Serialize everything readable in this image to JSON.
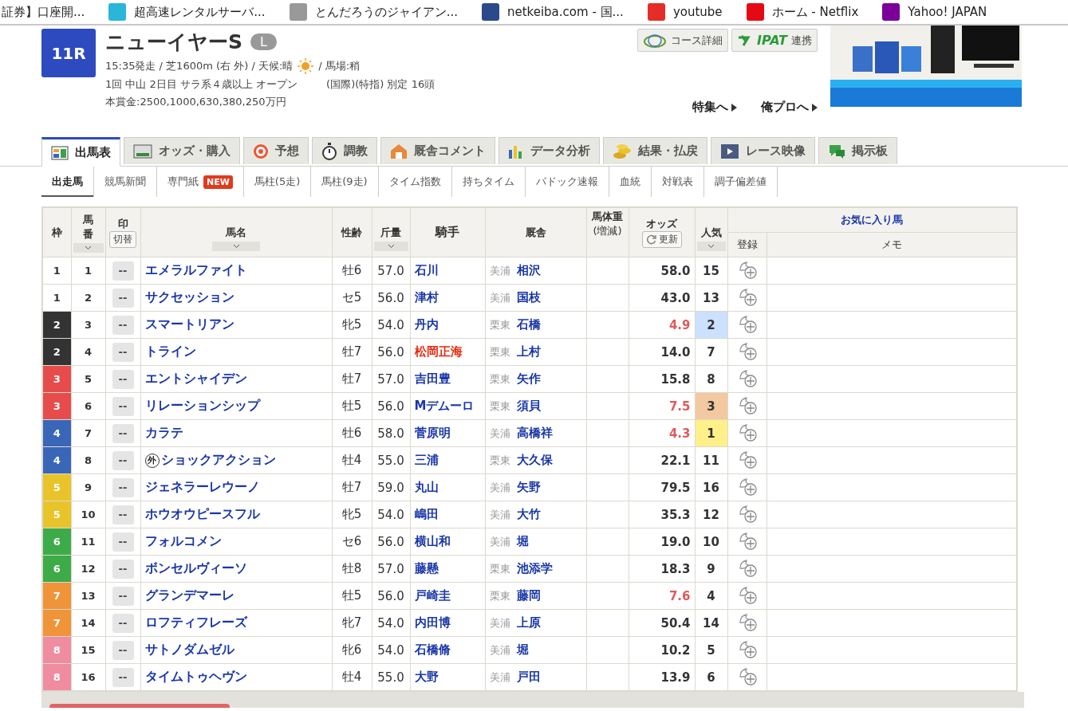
{
  "bookmarks": [
    {
      "label": "証券】口座開..."
    },
    {
      "label": "超高速レンタルサーバ..."
    },
    {
      "label": "とんだろうのジャイアン..."
    },
    {
      "label": "netkeiba.com - 国..."
    },
    {
      "label": "youtube"
    },
    {
      "label": "ホーム - Netflix"
    },
    {
      "label": "Yahoo! JAPAN"
    }
  ],
  "race": {
    "number": "11R",
    "name": "ニューイヤーS",
    "grade": "L",
    "line1_a": "15:35発走 / 芝1600m (右 外) / 天候:晴",
    "line1_b": "/ 馬場:稍",
    "line2_a": "1回 中山 2日目 サラ系４歳以上 オープン",
    "line2_b": "(国際)(特指) 別定 16頭",
    "prize": "本賞金:2500,1000,630,380,250万円"
  },
  "buttons": [
    {
      "kind": "course",
      "label": "コース詳細"
    },
    {
      "kind": "ipat",
      "logo": "IPAT",
      "label": "連携"
    }
  ],
  "links": [
    "特集へ",
    "俺プロへ"
  ],
  "tabs": [
    {
      "label": "出馬表",
      "selected": true
    },
    {
      "label": "オッズ・購入",
      "selected": false
    },
    {
      "label": "予想",
      "selected": false
    },
    {
      "label": "調教",
      "selected": false
    },
    {
      "label": "厩舎コメント",
      "selected": false
    },
    {
      "label": "データ分析",
      "selected": false
    },
    {
      "label": "結果・払戻",
      "selected": false
    },
    {
      "label": "レース映像",
      "selected": false
    },
    {
      "label": "掲示板",
      "selected": false
    }
  ],
  "subtabs": [
    {
      "label": "出走馬",
      "selected": true
    },
    {
      "label": "競馬新聞",
      "selected": false
    },
    {
      "label": "専門紙",
      "badge": "NEW",
      "selected": false
    },
    {
      "label": "馬柱(5走)",
      "selected": false
    },
    {
      "label": "馬柱(9走)",
      "selected": false
    },
    {
      "label": "タイム指数",
      "selected": false
    },
    {
      "label": "持ちタイム",
      "selected": false
    },
    {
      "label": "パドック速報",
      "selected": false
    },
    {
      "label": "血統",
      "selected": false
    },
    {
      "label": "対戦表",
      "selected": false
    },
    {
      "label": "調子偏差値",
      "selected": false
    }
  ],
  "table": {
    "headers": {
      "waku": "枠",
      "umaban": [
        "馬",
        "番"
      ],
      "mark": "印",
      "mark_toggle": "切替",
      "name": "馬名",
      "sex_age": "性齢",
      "weight": "斤量",
      "jockey": "騎手",
      "trainer": "厩舎",
      "body_weight": [
        "馬体重",
        "(増減)"
      ],
      "odds": "オッズ",
      "refresh": "更新",
      "popularity": "人気",
      "favorites": "お気に入り馬",
      "register": "登録",
      "memo": "メモ"
    },
    "mark_placeholder": "--",
    "rows": [
      {
        "waku": "1",
        "color": "#ffffff",
        "num": "1",
        "name": "エメラルファイト",
        "sex_age": "牡6",
        "weight": "57.0",
        "jockey": "石川",
        "jockey_alert": false,
        "region": "美浦",
        "trainer": "相沢",
        "odds": "58.0",
        "odds_hot": false,
        "popularity": {
          "text": "15"
        }
      },
      {
        "waku": "1",
        "color": "#ffffff",
        "num": "2",
        "name": "サクセッション",
        "sex_age": "セ5",
        "weight": "56.0",
        "jockey": "津村",
        "jockey_alert": false,
        "region": "美浦",
        "trainer": "国枝",
        "odds": "43.0",
        "odds_hot": false,
        "popularity": {
          "text": "13"
        }
      },
      {
        "waku": "2",
        "color": "#333333",
        "num": "3",
        "name": "スマートリアン",
        "sex_age": "牝5",
        "weight": "54.0",
        "jockey": "丹内",
        "jockey_alert": false,
        "region": "栗東",
        "trainer": "石橋",
        "odds": "4.9",
        "odds_hot": true,
        "popularity": {
          "text": "2",
          "color": "#cce0ff"
        }
      },
      {
        "waku": "2",
        "color": "#333333",
        "num": "4",
        "name": "トライン",
        "sex_age": "牡7",
        "weight": "56.0",
        "jockey": "松岡正海",
        "jockey_alert": true,
        "region": "栗東",
        "trainer": "上村",
        "odds": "14.0",
        "odds_hot": false,
        "popularity": {
          "text": "7"
        }
      },
      {
        "waku": "3",
        "color": "#e74c4c",
        "num": "5",
        "name": "エントシャイデン",
        "sex_age": "牡7",
        "weight": "57.0",
        "jockey": "吉田豊",
        "jockey_alert": false,
        "region": "栗東",
        "trainer": "矢作",
        "odds": "15.8",
        "odds_hot": false,
        "popularity": {
          "text": "8"
        }
      },
      {
        "waku": "3",
        "color": "#e74c4c",
        "num": "6",
        "name": "リレーションシップ",
        "sex_age": "牡5",
        "weight": "56.0",
        "jockey": "Mデムーロ",
        "jockey_alert": false,
        "region": "栗東",
        "trainer": "須貝",
        "odds": "7.5",
        "odds_hot": true,
        "popularity": {
          "text": "3",
          "color": "#f2c9a0"
        }
      },
      {
        "waku": "4",
        "color": "#3a66b8",
        "num": "7",
        "name": "カラテ",
        "sex_age": "牡6",
        "weight": "58.0",
        "jockey": "菅原明",
        "jockey_alert": false,
        "region": "美浦",
        "trainer": "高橋祥",
        "odds": "4.3",
        "odds_hot": true,
        "popularity": {
          "text": "1",
          "color": "#fff08a"
        }
      },
      {
        "waku": "4",
        "color": "#3a66b8",
        "num": "8",
        "foreign": "外",
        "name": "ショックアクション",
        "sex_age": "牡4",
        "weight": "55.0",
        "jockey": "三浦",
        "jockey_alert": false,
        "region": "栗東",
        "trainer": "大久保",
        "odds": "22.1",
        "odds_hot": false,
        "popularity": {
          "text": "11"
        }
      },
      {
        "waku": "5",
        "color": "#e8c42a",
        "num": "9",
        "name": "ジェネラーレウーノ",
        "sex_age": "牡7",
        "weight": "59.0",
        "jockey": "丸山",
        "jockey_alert": false,
        "region": "美浦",
        "trainer": "矢野",
        "odds": "79.5",
        "odds_hot": false,
        "popularity": {
          "text": "16"
        }
      },
      {
        "waku": "5",
        "color": "#e8c42a",
        "num": "10",
        "name": "ホウオウピースフル",
        "sex_age": "牝5",
        "weight": "54.0",
        "jockey": "嶋田",
        "jockey_alert": false,
        "region": "美浦",
        "trainer": "大竹",
        "odds": "35.3",
        "odds_hot": false,
        "popularity": {
          "text": "12"
        }
      },
      {
        "waku": "6",
        "color": "#3cab48",
        "num": "11",
        "name": "フォルコメン",
        "sex_age": "セ6",
        "weight": "56.0",
        "jockey": "横山和",
        "jockey_alert": false,
        "region": "美浦",
        "trainer": "堀",
        "odds": "19.0",
        "odds_hot": false,
        "popularity": {
          "text": "10"
        }
      },
      {
        "waku": "6",
        "color": "#3cab48",
        "num": "12",
        "name": "ボンセルヴィーソ",
        "sex_age": "牡8",
        "weight": "57.0",
        "jockey": "藤懸",
        "jockey_alert": false,
        "region": "栗東",
        "trainer": "池添学",
        "odds": "18.3",
        "odds_hot": false,
        "popularity": {
          "text": "9"
        }
      },
      {
        "waku": "7",
        "color": "#f0943a",
        "num": "13",
        "name": "グランデマーレ",
        "sex_age": "牡5",
        "weight": "56.0",
        "jockey": "戸崎圭",
        "jockey_alert": false,
        "region": "栗東",
        "trainer": "藤岡",
        "odds": "7.6",
        "odds_hot": true,
        "popularity": {
          "text": "4"
        }
      },
      {
        "waku": "7",
        "color": "#f0943a",
        "num": "14",
        "name": "ロフティフレーズ",
        "sex_age": "牝7",
        "weight": "54.0",
        "jockey": "内田博",
        "jockey_alert": false,
        "region": "美浦",
        "trainer": "上原",
        "odds": "50.4",
        "odds_hot": false,
        "popularity": {
          "text": "14"
        }
      },
      {
        "waku": "8",
        "color": "#f08ca0",
        "num": "15",
        "name": "サトノダムゼル",
        "sex_age": "牝6",
        "weight": "54.0",
        "jockey": "石橋脩",
        "jockey_alert": false,
        "region": "美浦",
        "trainer": "堀",
        "odds": "10.2",
        "odds_hot": false,
        "popularity": {
          "text": "5"
        }
      },
      {
        "waku": "8",
        "color": "#f08ca0",
        "num": "16",
        "name": "タイムトゥヘヴン",
        "sex_age": "牡4",
        "weight": "55.0",
        "jockey": "大野",
        "jockey_alert": false,
        "region": "美浦",
        "trainer": "戸田",
        "odds": "13.9",
        "odds_hot": false,
        "popularity": {
          "text": "6"
        }
      }
    ]
  }
}
